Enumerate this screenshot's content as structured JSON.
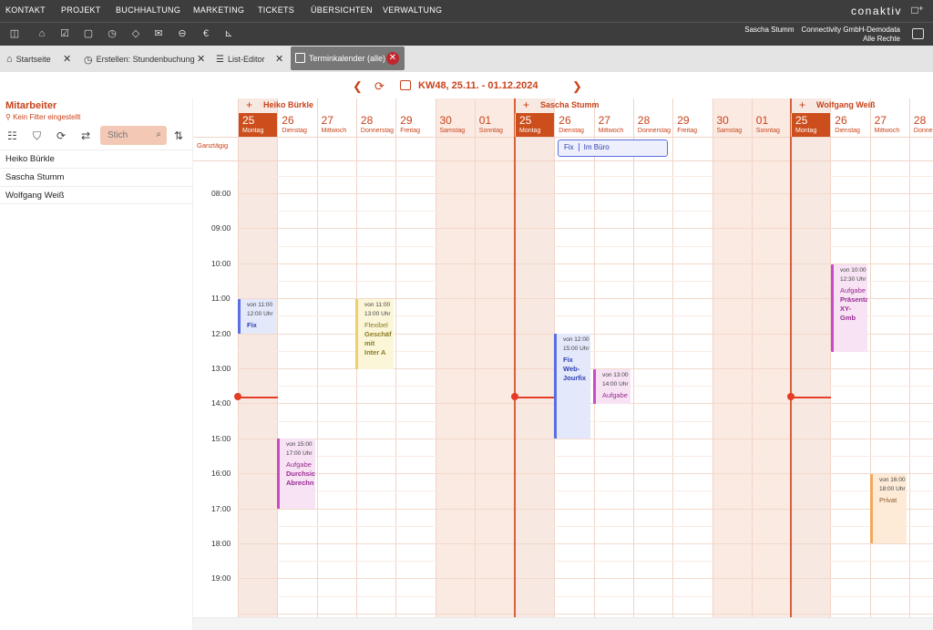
{
  "topnav": {
    "items": [
      "KONTAKT",
      "PROJEKT",
      "BUCHHALTUNG",
      "MARKETING",
      "TICKETS",
      "ÜBERSICHTEN",
      "VERWALTUNG"
    ],
    "logo": "conaktiv"
  },
  "toolbar": {
    "icons": [
      "sidebar-toggle-icon",
      "home-icon",
      "checklist-icon",
      "document-icon",
      "stopwatch-icon",
      "tag-icon",
      "mail-icon",
      "car-icon",
      "euro-icon",
      "chart-icon"
    ],
    "user_name": "Sascha Stumm",
    "company": "Connectivity GmbH-Demodata",
    "rights": "Alle Rechte"
  },
  "tabs": [
    {
      "label": "Startseite",
      "icon": "home-icon"
    },
    {
      "label": "Erstellen: Stundenbuchung",
      "icon": "stopwatch-icon"
    },
    {
      "label": "List-Editor",
      "icon": "list-edit-icon"
    },
    {
      "label": "Terminkalender (alle)",
      "icon": "calendar-icon",
      "active": true
    }
  ],
  "weeknav": {
    "label": "KW48, 25.11. - 01.12.2024"
  },
  "sidebar": {
    "title": "Mitarbeiter",
    "filter_text": "Kein Filter eingestellt",
    "search_placeholder": "Stich",
    "employees": [
      "Heiko Bürkle",
      "Sascha Stumm",
      "Wolfgang Weiß"
    ]
  },
  "calendar": {
    "allday_label": "Ganztägig",
    "times": [
      "08:00",
      "09:00",
      "10:00",
      "11:00",
      "12:00",
      "13:00",
      "14:00",
      "15:00",
      "16:00",
      "17:00",
      "18:00",
      "19:00"
    ],
    "resources": [
      {
        "name": "Heiko Bürkle",
        "days": [
          {
            "num": "25",
            "weekday": "Montag",
            "today": true
          },
          {
            "num": "26",
            "weekday": "Dienstag"
          },
          {
            "num": "27",
            "weekday": "Mittwoch"
          },
          {
            "num": "28",
            "weekday": "Donnerstag"
          },
          {
            "num": "29",
            "weekday": "Freitag"
          },
          {
            "num": "30",
            "weekday": "Samstag"
          },
          {
            "num": "01",
            "weekday": "Sonntag"
          }
        ]
      },
      {
        "name": "Sascha Stumm",
        "days": [
          {
            "num": "25",
            "weekday": "Montag",
            "today": true
          },
          {
            "num": "26",
            "weekday": "Dienstag"
          },
          {
            "num": "27",
            "weekday": "Mittwoch"
          },
          {
            "num": "28",
            "weekday": "Donnerstag"
          },
          {
            "num": "29",
            "weekday": "Freitag"
          },
          {
            "num": "30",
            "weekday": "Samstag"
          },
          {
            "num": "01",
            "weekday": "Sonntag"
          }
        ]
      },
      {
        "name": "Wolfgang Weiß",
        "days": [
          {
            "num": "25",
            "weekday": "Montag",
            "today": true
          },
          {
            "num": "26",
            "weekday": "Dienstag"
          },
          {
            "num": "27",
            "weekday": "Mittwoch"
          },
          {
            "num": "28",
            "weekday": "Donnerstag"
          }
        ]
      }
    ],
    "allday_event": {
      "type": "Fix",
      "title": "Im Büro"
    },
    "events": [
      {
        "t1": "von 11:00",
        "t2": "12:00 Uhr",
        "title": "Fix",
        "color": "blue"
      },
      {
        "t1": "von 11:00",
        "t2": "13:00 Uhr",
        "title": "Flexibel",
        "title2": "Geschäf mit Inter A",
        "color": "yellow"
      },
      {
        "t1": "von 15:00",
        "t2": "17:00 Uhr",
        "title": "Aufgabe",
        "title2": "Durchsic Abrechn",
        "color": "purple"
      },
      {
        "t1": "von 12:00",
        "t2": "15:00 Uhr",
        "title": "Fix",
        "title2": "Web-Jourfix",
        "color": "blue"
      },
      {
        "t1": "von 13:00",
        "t2": "14:00 Uhr",
        "title": "Aufgabe",
        "color": "purple"
      },
      {
        "t1": "von 10:00",
        "t2": "12:30 Uhr",
        "title": "Aufgabe",
        "title2": "Präsenta XY-Gmb",
        "color": "purple"
      },
      {
        "t1": "von 16:00",
        "t2": "18:00 Uhr",
        "title": "Privat",
        "color": "orange"
      }
    ]
  },
  "colors": {
    "accent": "#c9421a",
    "today_header": "#cc4e1c",
    "now_line": "#e53c27",
    "topbar": "#3d3d3d"
  }
}
